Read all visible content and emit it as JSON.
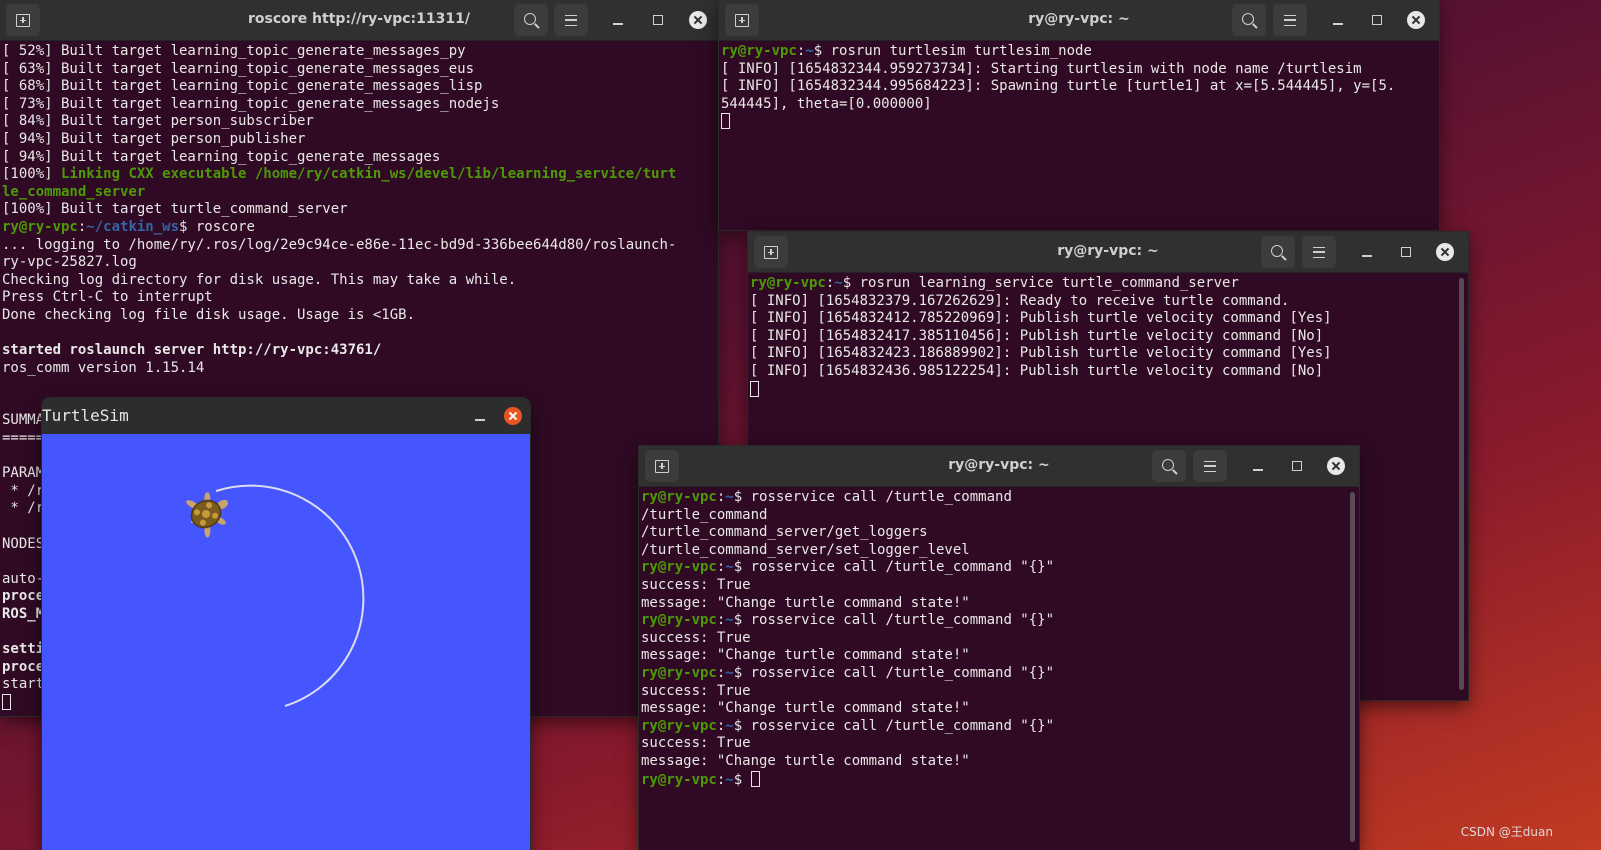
{
  "win1": {
    "title": "roscore http://ry-vpc:11311/",
    "lines": [
      [
        {
          "t": "[ 52%] Built target learning_topic_generate_messages_py",
          "c": ""
        }
      ],
      [
        {
          "t": "[ 63%] Built target learning_topic_generate_messages_eus",
          "c": ""
        }
      ],
      [
        {
          "t": "[ 68%] Built target learning_topic_generate_messages_lisp",
          "c": ""
        }
      ],
      [
        {
          "t": "[ 73%] Built target learning_topic_generate_messages_nodejs",
          "c": ""
        }
      ],
      [
        {
          "t": "[ 84%] Built target person_subscriber",
          "c": ""
        }
      ],
      [
        {
          "t": "[ 94%] Built target person_publisher",
          "c": ""
        }
      ],
      [
        {
          "t": "[ 94%] Built target learning_topic_generate_messages",
          "c": ""
        }
      ],
      [
        {
          "t": "[100%] ",
          "c": ""
        },
        {
          "t": "Linking CXX executable /home/ry/catkin_ws/devel/lib/learning_service/turt",
          "c": "gr"
        }
      ],
      [
        {
          "t": "le_command_server",
          "c": "gr"
        }
      ],
      [
        {
          "t": "[100%] Built target turtle_command_server",
          "c": ""
        }
      ],
      [
        {
          "t": "ry@ry-vpc",
          "c": "pu"
        },
        {
          "t": ":",
          "c": ""
        },
        {
          "t": "~/catkin_ws",
          "c": "pp"
        },
        {
          "t": "$ roscore",
          "c": ""
        }
      ],
      [
        {
          "t": "... logging to /home/ry/.ros/log/2e9c94ce-e86e-11ec-bd9d-336bee644d80/roslaunch-",
          "c": ""
        }
      ],
      [
        {
          "t": "ry-vpc-25827.log",
          "c": ""
        }
      ],
      [
        {
          "t": "Checking log directory for disk usage. This may take a while.",
          "c": ""
        }
      ],
      [
        {
          "t": "Press Ctrl-C to interrupt",
          "c": ""
        }
      ],
      [
        {
          "t": "Done checking log file disk usage. Usage is <1GB.",
          "c": ""
        }
      ],
      [
        {
          "t": "",
          "c": ""
        }
      ],
      [
        {
          "t": "started roslaunch server http://ry-vpc:43761/",
          "c": "bold"
        }
      ],
      [
        {
          "t": "ros_comm version 1.15.14",
          "c": ""
        }
      ],
      [
        {
          "t": "",
          "c": ""
        }
      ],
      [
        {
          "t": "",
          "c": ""
        }
      ],
      [
        {
          "t": "SUMMA",
          "c": ""
        }
      ],
      [
        {
          "t": "=====",
          "c": ""
        }
      ],
      [
        {
          "t": "",
          "c": ""
        }
      ],
      [
        {
          "t": "PARAM",
          "c": ""
        }
      ],
      [
        {
          "t": " * /r",
          "c": ""
        }
      ],
      [
        {
          "t": " * /r",
          "c": ""
        }
      ],
      [
        {
          "t": "",
          "c": ""
        }
      ],
      [
        {
          "t": "NODES",
          "c": ""
        }
      ],
      [
        {
          "t": "",
          "c": ""
        }
      ],
      [
        {
          "t": "auto-",
          "c": ""
        }
      ],
      [
        {
          "t": "proce",
          "c": "bold"
        }
      ],
      [
        {
          "t": "ROS_M",
          "c": "bold"
        }
      ],
      [
        {
          "t": "",
          "c": ""
        }
      ],
      [
        {
          "t": "setti",
          "c": "bold"
        }
      ],
      [
        {
          "t": "proce",
          "c": "bold"
        }
      ],
      [
        {
          "t": "start",
          "c": ""
        }
      ]
    ]
  },
  "win2": {
    "title": "ry@ry-vpc: ~",
    "lines": [
      [
        {
          "t": "ry@ry-vpc",
          "c": "pu"
        },
        {
          "t": ":",
          "c": ""
        },
        {
          "t": "~",
          "c": "pp"
        },
        {
          "t": "$ rosrun turtlesim turtlesim_node",
          "c": ""
        }
      ],
      [
        {
          "t": "[ INFO] [1654832344.959273734]: Starting turtlesim with node name /turtlesim",
          "c": ""
        }
      ],
      [
        {
          "t": "[ INFO] [1654832344.995684223]: Spawning turtle [turtle1] at x=[5.544445], y=[5.",
          "c": ""
        }
      ],
      [
        {
          "t": "544445], theta=[0.000000]",
          "c": ""
        }
      ]
    ]
  },
  "win3": {
    "title": "ry@ry-vpc: ~",
    "lines": [
      [
        {
          "t": "ry@ry-vpc",
          "c": "pu"
        },
        {
          "t": ":",
          "c": ""
        },
        {
          "t": "~",
          "c": "pp"
        },
        {
          "t": "$ rosrun learning_service turtle_command_server",
          "c": ""
        }
      ],
      [
        {
          "t": "[ INFO] [1654832379.167262629]: Ready to receive turtle command.",
          "c": ""
        }
      ],
      [
        {
          "t": "[ INFO] [1654832412.785220969]: Publish turtle velocity command [Yes]",
          "c": ""
        }
      ],
      [
        {
          "t": "[ INFO] [1654832417.385110456]: Publish turtle velocity command [No]",
          "c": ""
        }
      ],
      [
        {
          "t": "[ INFO] [1654832423.186889902]: Publish turtle velocity command [Yes]",
          "c": ""
        }
      ],
      [
        {
          "t": "[ INFO] [1654832436.985122254]: Publish turtle velocity command [No]",
          "c": ""
        }
      ]
    ]
  },
  "win4": {
    "title": "ry@ry-vpc: ~",
    "lines": [
      [
        {
          "t": "ry@ry-vpc",
          "c": "pu"
        },
        {
          "t": ":",
          "c": ""
        },
        {
          "t": "~",
          "c": "pp"
        },
        {
          "t": "$ rosservice call /turtle_command",
          "c": ""
        }
      ],
      [
        {
          "t": "/turtle_command",
          "c": ""
        }
      ],
      [
        {
          "t": "/turtle_command_server/get_loggers",
          "c": ""
        }
      ],
      [
        {
          "t": "/turtle_command_server/set_logger_level",
          "c": ""
        }
      ],
      [
        {
          "t": "ry@ry-vpc",
          "c": "pu"
        },
        {
          "t": ":",
          "c": ""
        },
        {
          "t": "~",
          "c": "pp"
        },
        {
          "t": "$ rosservice call /turtle_command \"{}\"",
          "c": ""
        }
      ],
      [
        {
          "t": "success: True",
          "c": ""
        }
      ],
      [
        {
          "t": "message: \"Change turtle command state!\"",
          "c": ""
        }
      ],
      [
        {
          "t": "ry@ry-vpc",
          "c": "pu"
        },
        {
          "t": ":",
          "c": ""
        },
        {
          "t": "~",
          "c": "pp"
        },
        {
          "t": "$ rosservice call /turtle_command \"{}\"",
          "c": ""
        }
      ],
      [
        {
          "t": "success: True",
          "c": ""
        }
      ],
      [
        {
          "t": "message: \"Change turtle command state!\"",
          "c": ""
        }
      ],
      [
        {
          "t": "ry@ry-vpc",
          "c": "pu"
        },
        {
          "t": ":",
          "c": ""
        },
        {
          "t": "~",
          "c": "pp"
        },
        {
          "t": "$ rosservice call /turtle_command \"{}\"",
          "c": ""
        }
      ],
      [
        {
          "t": "success: True",
          "c": ""
        }
      ],
      [
        {
          "t": "message: \"Change turtle command state!\"",
          "c": ""
        }
      ],
      [
        {
          "t": "ry@ry-vpc",
          "c": "pu"
        },
        {
          "t": ":",
          "c": ""
        },
        {
          "t": "~",
          "c": "pp"
        },
        {
          "t": "$ rosservice call /turtle_command \"{}\"",
          "c": ""
        }
      ],
      [
        {
          "t": "success: True",
          "c": ""
        }
      ],
      [
        {
          "t": "message: \"Change turtle command state!\"",
          "c": ""
        }
      ],
      [
        {
          "t": "ry@ry-vpc",
          "c": "pu"
        },
        {
          "t": ":",
          "c": ""
        },
        {
          "t": "~",
          "c": "pp"
        },
        {
          "t": "$ ",
          "c": ""
        }
      ]
    ]
  },
  "turtlesim": {
    "title": "TurtleSim",
    "bg_color": "#4556ff",
    "trail_color": "#dcdcf0"
  },
  "watermark": "CSDN @王duan",
  "colors": {
    "terminal_bg": "#300a24",
    "prompt_user": "#4e9a06",
    "prompt_path": "#3465a4"
  }
}
